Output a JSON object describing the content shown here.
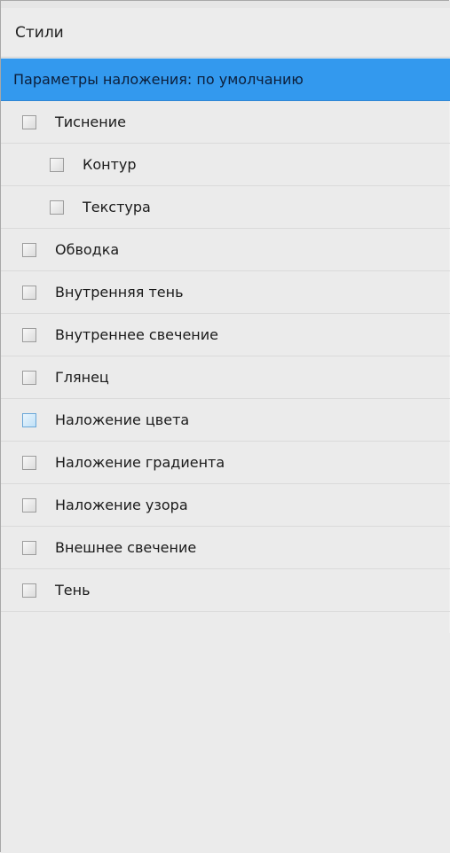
{
  "panel": {
    "title": "Стили"
  },
  "list": {
    "selected_label": "Параметры наложения: по умолчанию",
    "items": [
      {
        "label": "Тиснение",
        "checked": false,
        "level": 0
      },
      {
        "label": "Контур",
        "checked": false,
        "level": 1
      },
      {
        "label": "Текстура",
        "checked": false,
        "level": 1
      },
      {
        "label": "Обводка",
        "checked": false,
        "level": 0
      },
      {
        "label": "Внутренняя тень",
        "checked": false,
        "level": 0
      },
      {
        "label": "Внутреннее свечение",
        "checked": false,
        "level": 0
      },
      {
        "label": "Глянец",
        "checked": false,
        "level": 0
      },
      {
        "label": "Наложение цвета",
        "checked": false,
        "level": 0,
        "hover": true
      },
      {
        "label": "Наложение градиента",
        "checked": false,
        "level": 0
      },
      {
        "label": "Наложение узора",
        "checked": false,
        "level": 0
      },
      {
        "label": "Внешнее свечение",
        "checked": false,
        "level": 0
      },
      {
        "label": "Тень",
        "checked": false,
        "level": 0
      }
    ]
  },
  "colors": {
    "selection": "#3399ee",
    "panel_bg": "#ebebeb"
  }
}
